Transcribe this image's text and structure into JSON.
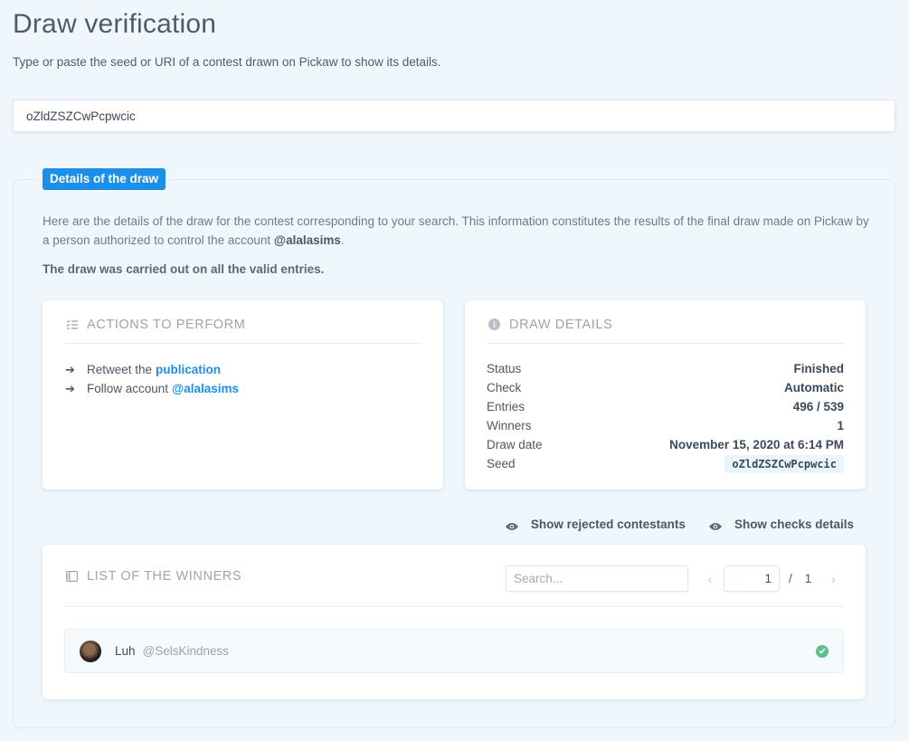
{
  "page": {
    "title": "Draw verification",
    "subtitle": "Type or paste the seed or URI of a contest drawn on Pickaw to show its details."
  },
  "seed_input": {
    "value": "oZldZSZCwPcpwcic"
  },
  "details_section": {
    "legend": "Details of the draw",
    "intro_text": "Here are the details of the draw for the contest corresponding to your search. This information constitutes the results of the final draw made on Pickaw by a person authorized to control the account ",
    "intro_account": "@alalasims",
    "intro_end": ".",
    "valid_entries_note": "The draw was carried out on all the valid entries."
  },
  "actions_card": {
    "title": "Actions to perform",
    "items": [
      {
        "text": "Retweet the",
        "link": "publication"
      },
      {
        "text": "Follow account",
        "link": "@alalasims"
      }
    ]
  },
  "draw_details_card": {
    "title": "Draw details",
    "rows": [
      {
        "key": "Status",
        "value": "Finished"
      },
      {
        "key": "Check",
        "value": "Automatic"
      },
      {
        "key": "Entries",
        "value": "496 / 539"
      },
      {
        "key": "Winners",
        "value": "1"
      },
      {
        "key": "Draw date",
        "value": "November 15, 2020 at 6:14 PM"
      },
      {
        "key": "Seed",
        "value": "oZldZSZCwPcpwcic"
      }
    ]
  },
  "toggles": {
    "rejected": "Show rejected contestants",
    "checks": "Show checks details"
  },
  "winners_card": {
    "title": "List of the winners",
    "search_placeholder": "Search...",
    "page_current": "1",
    "page_separator": "/",
    "page_total": "1",
    "winners": [
      {
        "name": "Luh",
        "handle": "@SelsKindness",
        "verified": true
      }
    ]
  },
  "colors": {
    "accent": "#1c8fe8",
    "background": "#eff7fd",
    "success": "#5bc08a"
  }
}
